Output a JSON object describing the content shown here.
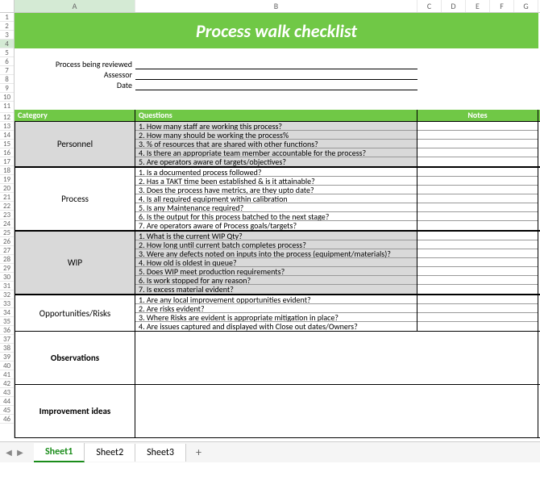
{
  "columns": [
    "A",
    "B",
    "C",
    "D",
    "E",
    "F",
    "G"
  ],
  "selected_row": "4",
  "title": "Process walk checklist",
  "headers": {
    "process_label": "Process being reviewed",
    "assessor_label": "Assessor",
    "date_label": "Date"
  },
  "table_header": {
    "category": "Category",
    "questions": "Questions",
    "notes": "Notes"
  },
  "sections": [
    {
      "name": "Personnel",
      "shaded": true,
      "questions": [
        "1.  How many staff are working this process?",
        "2.  How many should be working the process%",
        "3. % of resources that are shared with other functions?",
        "4. Is there an appropriate team member accountable for the process?",
        "5. Are operators aware of targets/objectives?"
      ]
    },
    {
      "name": "Process",
      "shaded": false,
      "questions": [
        "1. Is a documented process followed?",
        "2. Has a TAKT time been established & is it attainable?",
        "3. Does the process have metrics, are they upto date?",
        "4. Is all required equipment within calibration",
        "5. Is any Maintenance required?",
        "6. Is the output for this process batched to the next stage?",
        "7. Are operators aware of Process goals/targets?"
      ]
    },
    {
      "name": "WIP",
      "shaded": true,
      "questions": [
        "1.  What is the current WIP Qty?",
        "2. How long until current batch completes process?",
        "3. Were any defects noted on inputs into the process (equipment/materials)?",
        "4. How old is oldest in queue?",
        "5. Does WIP meet production requirements?",
        "6. Is work stopped for any reason?",
        "7. Is excess material evident?"
      ]
    },
    {
      "name": "Opportunities/Risks",
      "shaded": false,
      "questions": [
        "1. Are any local improvement opportunities evident?",
        "2.  Are risks evident?",
        "3. Where Risks are evident is appropriate mitigation in place?",
        "4. Are issues captured and displayed with Close out dates/Owners?"
      ]
    }
  ],
  "tall_sections": [
    {
      "name": "Observations"
    },
    {
      "name": "Improvement ideas"
    }
  ],
  "tabs": {
    "active": "Sheet1",
    "others": [
      "Sheet2",
      "Sheet3"
    ]
  },
  "colors": {
    "accent": "#70c846"
  }
}
